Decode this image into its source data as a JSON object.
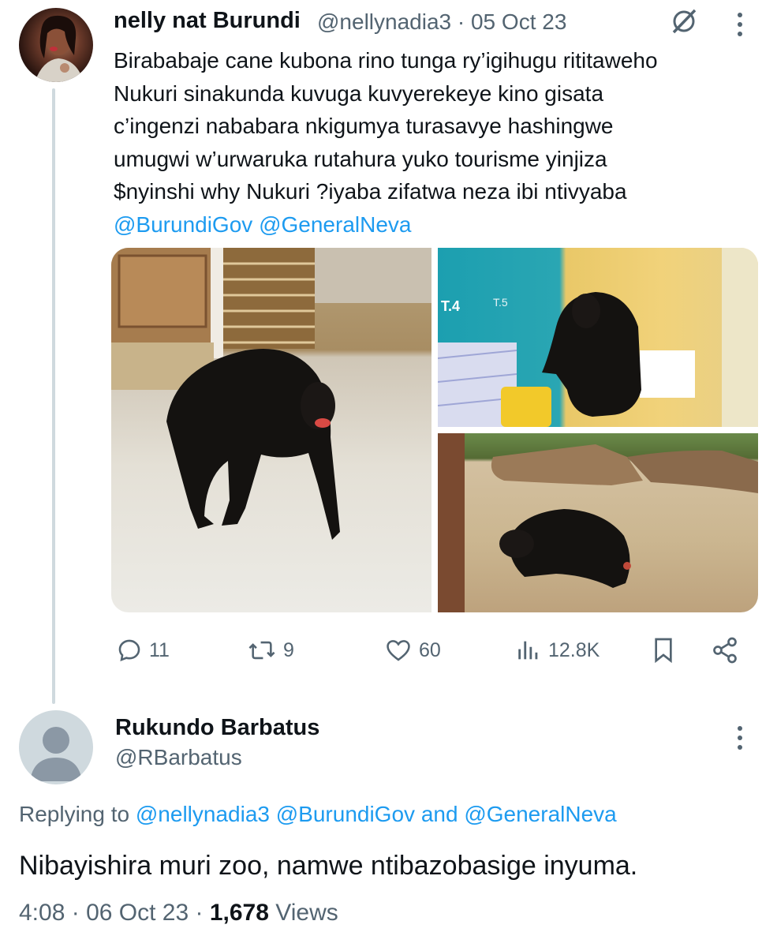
{
  "tweet": {
    "author_name": "nelly nat Burundi",
    "author_handle": "@nellynadia3",
    "separator": "·",
    "date": "05 Oct 23",
    "text_lines": [
      "Birababaje cane kubona rino tunga ry’igihugu rititaweho",
      "Nukuri sinakunda kuvuga kuvyerekeye kino gisata",
      "c’ingenzi nababara nkigumya turasavye hashingwe",
      "umugwi w’urwaruka rutahura yuko  tourisme yinjiza",
      "$nyinshi why Nukuri ?iyaba zifatwa neza ibi ntivyaba"
    ],
    "mentions": [
      "@BurundiGov",
      "@GeneralNeva"
    ],
    "stats": {
      "replies": "11",
      "reposts": "9",
      "likes": "60",
      "views": "12.8K"
    },
    "icons": [
      "grok-icon",
      "more-icon",
      "reply-icon",
      "repost-icon",
      "like-icon",
      "views-icon",
      "bookmark-icon",
      "share-icon"
    ]
  },
  "reply": {
    "author_name": "Rukundo Barbatus",
    "author_handle": "@RBarbatus",
    "replying_prefix": "Replying to",
    "replying_mentions": [
      "@nellynadia3",
      "@BurundiGov"
    ],
    "replying_and": "and",
    "replying_last": "@GeneralNeva",
    "text": "Nibayishira muri zoo, namwe ntibazobasige inyuma.",
    "time": "4:08",
    "separator": "·",
    "date": "06 Oct 23",
    "views_count": "1,678",
    "views_label": "Views"
  },
  "media_labels": {
    "sign_1": "T.4",
    "sign_2": "T.5"
  },
  "colors": {
    "accent": "#1d9bf0",
    "muted": "#536471",
    "text": "#0f1419",
    "divider": "#cfd9de"
  }
}
